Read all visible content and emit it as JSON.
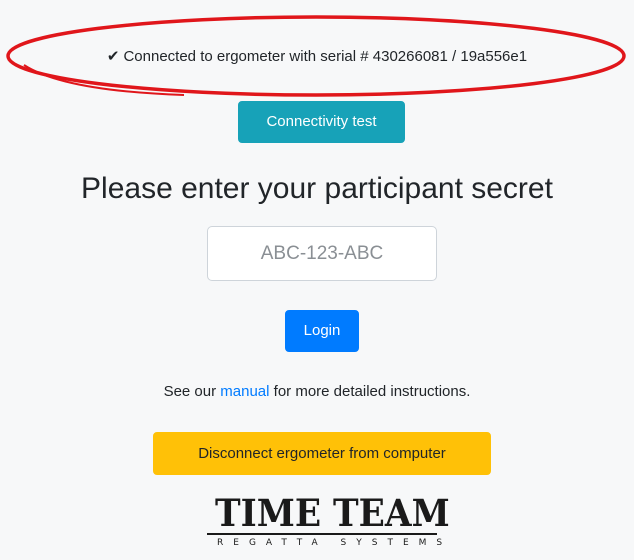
{
  "status": {
    "icon": "checkmark-icon",
    "check_glyph": "✔",
    "text": "Connected to ergometer with serial # 430266081 / 19a556e1"
  },
  "annotation": {
    "shape": "ellipse",
    "color": "#e0161b"
  },
  "buttons": {
    "connectivity_label": "Connectivity test",
    "login_label": "Login",
    "disconnect_label": "Disconnect ergometer from computer"
  },
  "login_form": {
    "heading": "Please enter your participant secret",
    "secret_placeholder": "ABC-123-ABC",
    "secret_value": ""
  },
  "help": {
    "prefix": "See our ",
    "link_text": "manual",
    "suffix": " for more detailed instructions."
  },
  "logo": {
    "main": "TIME TEAM",
    "sub": "REGATTA SYSTEMS"
  },
  "colors": {
    "connectivity_button": "#17a2b8",
    "login_button": "#007bff",
    "disconnect_button": "#ffc107",
    "link": "#007bff",
    "annotation": "#e0161b"
  }
}
